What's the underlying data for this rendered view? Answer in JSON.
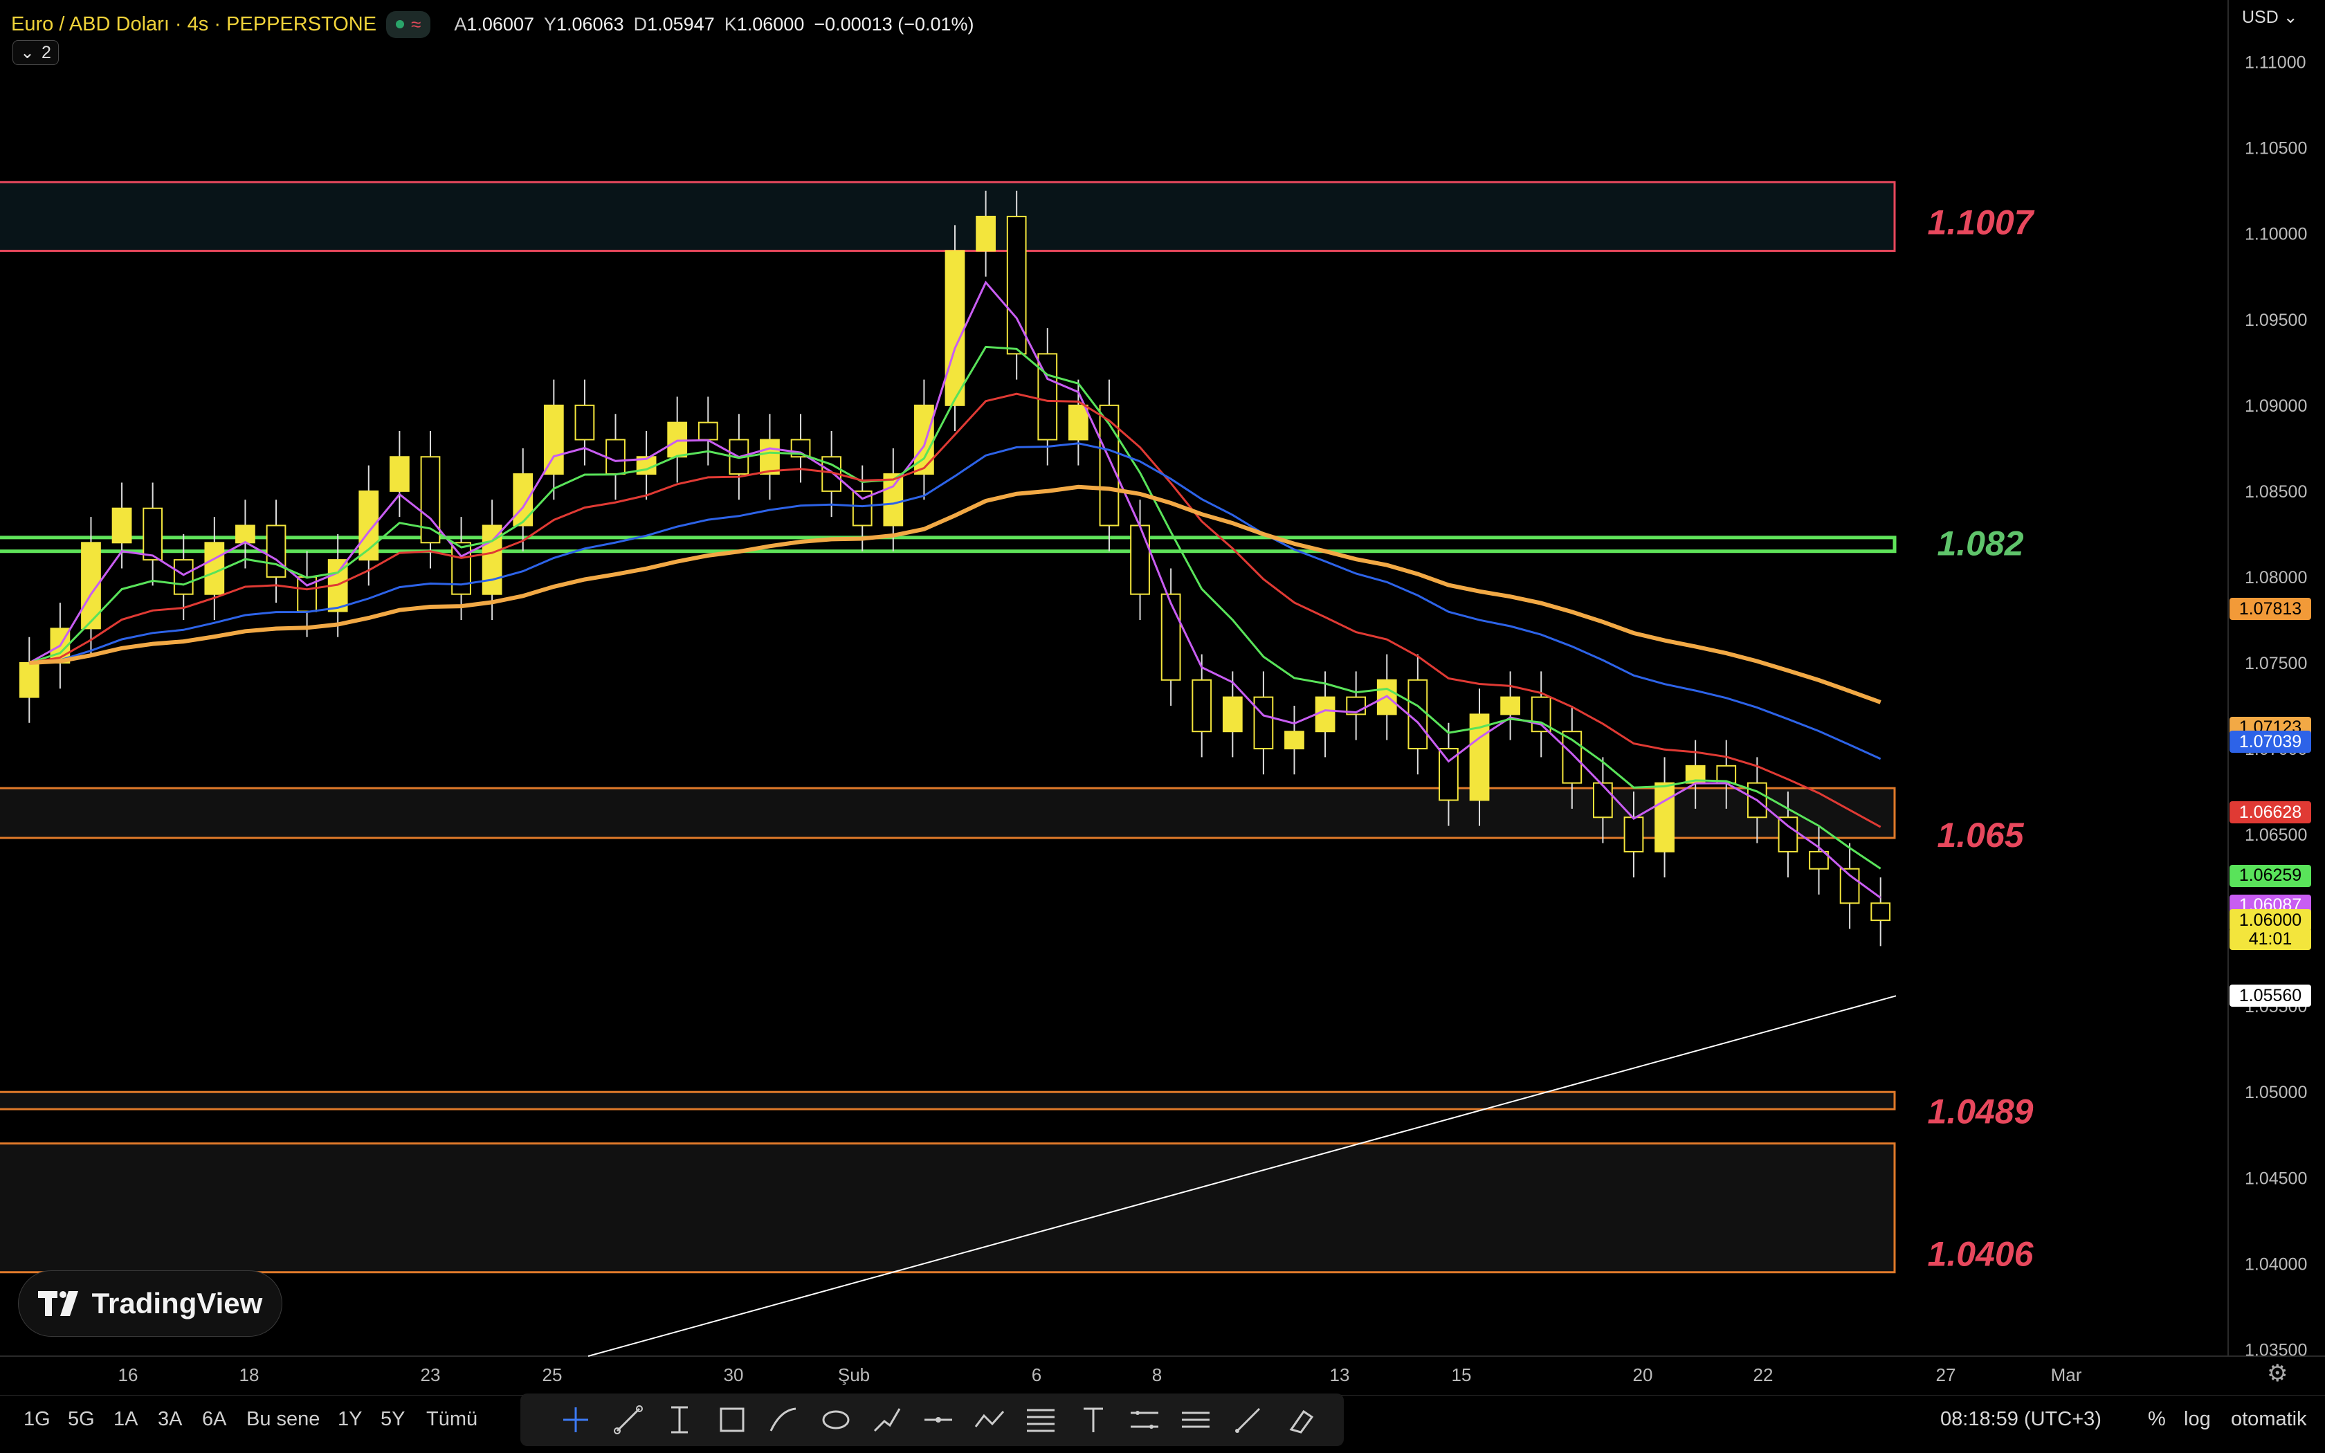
{
  "header": {
    "symbol": "Euro / ABD Doları · 4s · PEPPERSTONE",
    "ohlc": [
      {
        "k": "A",
        "v": "1.06007"
      },
      {
        "k": "Y",
        "v": "1.06063"
      },
      {
        "k": "D",
        "v": "1.05947"
      },
      {
        "k": "K",
        "v": "1.06000"
      }
    ],
    "change": "−0.00013 (−0.01%)",
    "indicator_count": "2",
    "wave_glyph": "≈"
  },
  "currency": "USD",
  "price_axis": [
    "1.11000",
    "1.10500",
    "1.10000",
    "1.09500",
    "1.09000",
    "1.08500",
    "1.08000",
    "1.07500",
    "1.07000",
    "1.06500",
    "1.06000",
    "1.05500",
    "1.05000",
    "1.04500",
    "1.04000",
    "1.03500"
  ],
  "time_axis": [
    "16",
    "18",
    "23",
    "25",
    "30",
    "Şub",
    "6",
    "8",
    "13",
    "15",
    "20",
    "22",
    "27",
    "Mar"
  ],
  "level_labels": [
    {
      "text": "1.1007",
      "color": "#e8485d"
    },
    {
      "text": "1.082",
      "color": "#5fc46b"
    },
    {
      "text": "1.065",
      "color": "#e8485d"
    },
    {
      "text": "1.0489",
      "color": "#e8485d"
    },
    {
      "text": "1.0406",
      "color": "#e8485d"
    }
  ],
  "price_tags": [
    {
      "text": "1.07813",
      "bg": "#f29a38"
    },
    {
      "text": "1.07123",
      "bg": "#f2a945"
    },
    {
      "text": "1.07039",
      "bg": "#2d63e8",
      "fg": "#fff"
    },
    {
      "text": "1.06628",
      "bg": "#e03a34",
      "fg": "#fff"
    },
    {
      "text": "1.06259",
      "bg": "#59e35a"
    },
    {
      "text": "1.06087",
      "bg": "#c85df2",
      "fg": "#fff"
    },
    {
      "text": "1.06000",
      "bg": "#f3e53c"
    },
    {
      "text": "41:01",
      "bg": "#f3e53c"
    },
    {
      "text": "1.05560",
      "bg": "#ffffff"
    }
  ],
  "bottom": {
    "ranges": [
      "1G",
      "5G",
      "1A",
      "3A",
      "6A",
      "Bu sene",
      "1Y",
      "5Y",
      "Tümü"
    ],
    "time": "08:18:59 (UTC+3)",
    "percent": "%",
    "log": "log",
    "auto": "otomatik"
  },
  "logo_text": "TradingView",
  "colors": {
    "candle": "#f3e53c",
    "resistance_box": "#e8485d",
    "support_box": "#e07a2a",
    "green_box": "#5fe35a",
    "ema_purple": "#c85df2",
    "ema_green": "#59e35a",
    "ema_red": "#e03a34",
    "ema_blue": "#2d63e8",
    "ema_orange": "#f2a945",
    "ema_white": "#ffffff"
  },
  "chart_data": {
    "type": "candlestick",
    "title": "Euro / ABD Doları · 4s · PEPPERSTONE",
    "ylim": [
      1.033,
      1.112
    ],
    "levels": [
      1.1007,
      1.082,
      1.065,
      1.0489,
      1.0406
    ],
    "zones": [
      {
        "from": 1.099,
        "to": 1.103,
        "color": "resistance"
      },
      {
        "from": 1.0815,
        "to": 1.0823,
        "color": "green"
      },
      {
        "from": 1.0648,
        "to": 1.0677,
        "color": "support"
      },
      {
        "from": 1.049,
        "to": 1.05,
        "color": "support"
      },
      {
        "from": 1.0395,
        "to": 1.047,
        "color": "support"
      }
    ],
    "close_series": [
      1.075,
      1.077,
      1.082,
      1.084,
      1.081,
      1.079,
      1.082,
      1.083,
      1.08,
      1.078,
      1.081,
      1.085,
      1.087,
      1.082,
      1.079,
      1.083,
      1.086,
      1.09,
      1.088,
      1.086,
      1.087,
      1.089,
      1.088,
      1.086,
      1.088,
      1.087,
      1.085,
      1.083,
      1.086,
      1.09,
      1.099,
      1.101,
      1.093,
      1.088,
      1.09,
      1.083,
      1.079,
      1.074,
      1.071,
      1.073,
      1.07,
      1.071,
      1.073,
      1.072,
      1.074,
      1.07,
      1.067,
      1.072,
      1.073,
      1.071,
      1.068,
      1.066,
      1.064,
      1.068,
      1.069,
      1.068,
      1.066,
      1.064,
      1.063,
      1.061,
      1.06
    ]
  }
}
